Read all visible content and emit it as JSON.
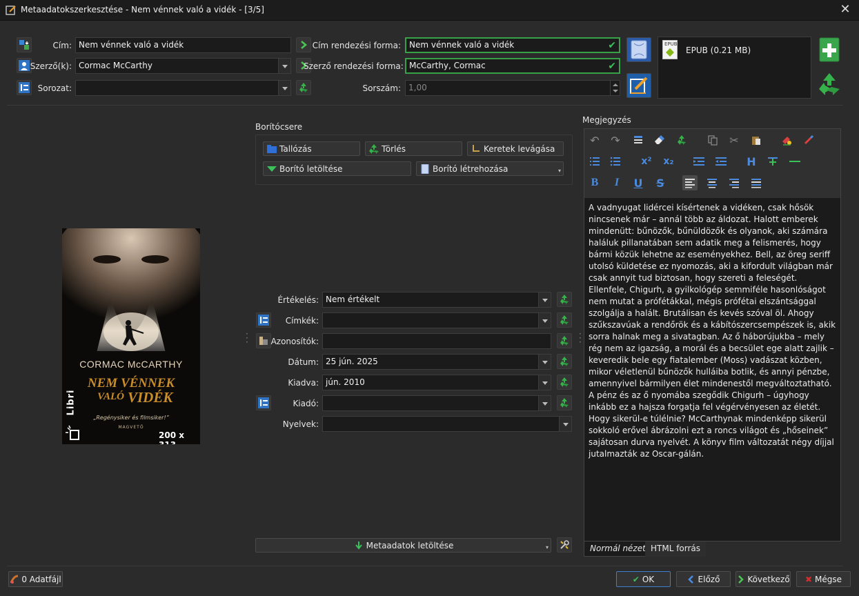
{
  "window": {
    "title": "Metaadatokszerkesztése - Nem vénnek való a vidék - [3/5]"
  },
  "top": {
    "title_label": "Cím:",
    "title_value": "Nem vénnek való a vidék",
    "author_label": "Szerző(k):",
    "author_value": "Cormac McCarthy",
    "series_label": "Sorozat:",
    "series_value": "",
    "title_sort_label": "Cím rendezési forma:",
    "title_sort_value": "Nem vénnek való a vidék",
    "author_sort_label": "Szerző rendezési forma:",
    "author_sort_value": "McCarthy, Cormac",
    "series_index_label": "Sorszám:",
    "series_index_value": "1,00"
  },
  "formats": {
    "items": [
      {
        "label": "EPUB (0.21 MB)",
        "badge": "EPUB"
      }
    ]
  },
  "cover": {
    "group_label": "Borítócsere",
    "browse_label": "Tallózás",
    "delete_label": "Törlés",
    "trim_label": "Keretek levágása",
    "download_label": "Borító letöltése",
    "generate_label": "Borító létrehozása",
    "size_label": "200 x 313",
    "art": {
      "author": "CORMAC McCARTHY",
      "title_line1": "NEM VÉNNEK",
      "title_line2": "VALÓ",
      "title_line3": "VIDÉK",
      "tagline": "„Regénysiker és filmsiker!”",
      "publisher": "MAGVETŐ",
      "brand": "Libri"
    }
  },
  "meta": {
    "rating_label": "Értékelés:",
    "rating_value": "Nem értékelt",
    "tags_label": "Címkék:",
    "tags_value": "",
    "ids_label": "Azonosítók:",
    "ids_value": "",
    "date_label": "Dátum:",
    "date_value": "25 jún. 2025",
    "pub_label": "Kiadva:",
    "pub_value": "jún. 2010",
    "publisher_label": "Kiadó:",
    "publisher_value": "",
    "lang_label": "Nyelvek:",
    "lang_value": ""
  },
  "fetch": {
    "label": "Metaadatok letöltése"
  },
  "comments": {
    "label": "Megjegyzés",
    "text": "A vadnyugat lidércei kísértenek a vidéken, csak hősök nincsenek már – annál több az áldozat. Halott emberek mindenütt: bűnözők, bűnüldözők és olyanok, aki számára haláluk pillanatában sem adatik meg a felismerés, hogy bármi közük lehetne az eseményekhez. Bell, az öreg seriff utolsó küldetése ez nyomozás, aki a kifordult világban már csak annyit tud biztosan, hogy szereti a feleségét. Ellenfele, Chigurh, a gyilkológép semmiféle hasonlóságot nem mutat a prófétákkal, mégis prófétai elszántsággal szolgálja a halált. Brutálisan és kevés szóval öl. Ahogy szűkszavúak a rendőrök és a kábítószercsempészek is, akik sorra halnak meg a sivatagban. Az ő háborújukba – mely rég nem az igazság, a morál és a becsület ege alatt zajlik – keveredik bele egy fiatalember (Moss) vadászat közben, mikor véletlenül bűnözők hulláiba botlik, és annyi pénzbe, amennyivel bármilyen élet mindenestől megváltoztatható. A pénz és az ő nyomába szegődik Chigurh – úgyhogy inkább ez a hajsza forgatja fel végérvényesen az életét. Hogy sikerül-e túlélnie? McCarthynak mindenképp sikerül sokkoló erővel ábrázolni ezt a roncs világot és „hőseinek” sajátosan durva nyelvét. A könyv film változatát négy díjjal jutalmazták az Oscar-gálán.",
    "tab_normal": "Normál nézet",
    "tab_html": "HTML forrás"
  },
  "footer": {
    "datafiles_label": "0 Adatfájl",
    "ok_label": "OK",
    "prev_label": "Előző",
    "next_label": "Következő",
    "cancel_label": "Mégse"
  },
  "colors": {
    "accent_green": "#37a24a",
    "ok_border": "#3f7fd0",
    "cancel_red": "#d0302b"
  }
}
